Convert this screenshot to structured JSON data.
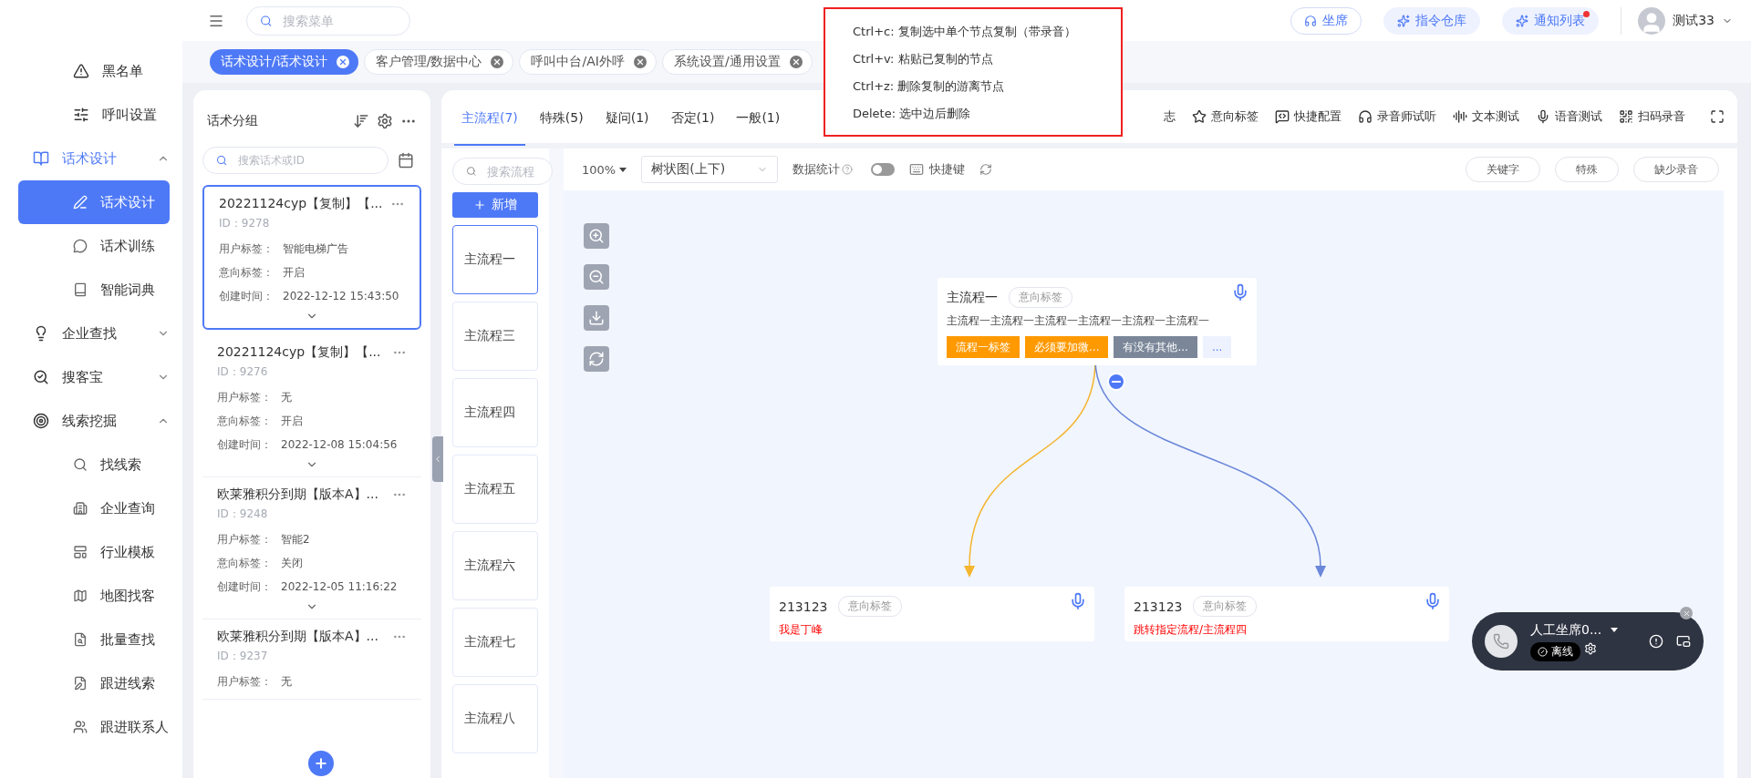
{
  "sidebar": {
    "items": [
      {
        "kind": "item",
        "label": "黑名单",
        "selected": false
      },
      {
        "kind": "item",
        "label": "呼叫设置",
        "selected": false
      },
      {
        "kind": "group",
        "label": "话术设计",
        "expanded": true,
        "selected": true,
        "children": [
          {
            "label": "话术设计",
            "selected": true
          },
          {
            "label": "话术训练",
            "selected": false
          },
          {
            "label": "智能词典",
            "selected": false
          }
        ]
      },
      {
        "kind": "group",
        "label": "企业查找",
        "expanded": false,
        "selected": false
      },
      {
        "kind": "group",
        "label": "搜客宝",
        "expanded": false,
        "selected": false
      },
      {
        "kind": "group",
        "label": "线索挖掘",
        "expanded": true,
        "selected": false,
        "children": [
          {
            "label": "找线索",
            "selected": false
          },
          {
            "label": "企业查询",
            "selected": false
          },
          {
            "label": "行业模板",
            "selected": false
          },
          {
            "label": "地图找客",
            "selected": false
          },
          {
            "label": "批量查找",
            "selected": false
          },
          {
            "label": "跟进线索",
            "selected": false
          },
          {
            "label": "跟进联系人",
            "selected": false
          }
        ]
      }
    ]
  },
  "header": {
    "search": {
      "placeholder": "搜索菜单"
    },
    "buttons": [
      {
        "label": "坐席",
        "kind": "outline",
        "badge": false
      },
      {
        "label": "指令仓库",
        "kind": "soft",
        "badge": false
      },
      {
        "label": "通知列表",
        "kind": "soft",
        "badge": true
      }
    ],
    "user": "测试33"
  },
  "open_tabs": [
    {
      "label": "话术设计/话术设计",
      "selected": true
    },
    {
      "label": "客户管理/数据中心",
      "selected": false
    },
    {
      "label": "呼叫中台/AI外呼",
      "selected": false
    },
    {
      "label": "系统设置/通用设置",
      "selected": false
    }
  ],
  "script_panel": {
    "title": "话术分组",
    "search": {
      "placeholder": "搜索话术或ID"
    },
    "cards": [
      {
        "title": "20221124cyp【复制】【...",
        "id": "ID：9278",
        "selected": true,
        "fields": [
          {
            "label": "用户标签：",
            "value": "智能电梯广告"
          },
          {
            "label": "意向标签：",
            "value": "开启"
          },
          {
            "label": "创建时间：",
            "value": "2022-12-12 15:43:50"
          }
        ]
      },
      {
        "title": "20221124cyp【复制】【...",
        "id": "ID：9276",
        "selected": false,
        "fields": [
          {
            "label": "用户标签：",
            "value": "无"
          },
          {
            "label": "意向标签：",
            "value": "开启"
          },
          {
            "label": "创建时间：",
            "value": "2022-12-08 15:04:56"
          }
        ]
      },
      {
        "title": "欧莱雅积分到期【版本A】...",
        "id": "ID：9248",
        "selected": false,
        "fields": [
          {
            "label": "用户标签：",
            "value": "智能2"
          },
          {
            "label": "意向标签：",
            "value": "关闭"
          },
          {
            "label": "创建时间：",
            "value": "2022-12-05 11:16:22"
          }
        ]
      },
      {
        "title": "欧莱雅积分到期【版本A】...",
        "id": "ID：9237",
        "selected": false,
        "fields": [
          {
            "label": "用户标签：",
            "value": "无"
          }
        ]
      }
    ]
  },
  "tabs": [
    {
      "label": "主流程(7)",
      "selected": true
    },
    {
      "label": "特殊(5)",
      "selected": false
    },
    {
      "label": "疑问(1)",
      "selected": false
    },
    {
      "label": "否定(1)",
      "selected": false
    },
    {
      "label": "一般(1)",
      "selected": false
    }
  ],
  "toolbar_actions": [
    {
      "label": "志",
      "kind": "text"
    },
    {
      "label": "意向标签",
      "kind": "star"
    },
    {
      "label": "快捷配置",
      "kind": "config"
    },
    {
      "label": "录音师试听",
      "kind": "headphones"
    },
    {
      "label": "文本测试",
      "kind": "wave"
    },
    {
      "label": "语音测试",
      "kind": "mic"
    },
    {
      "label": "扫码录音",
      "kind": "scan"
    }
  ],
  "flow_panel": {
    "search": {
      "placeholder": "搜索流程"
    },
    "add_button": "新增",
    "flows": [
      {
        "label": "主流程一",
        "selected": true
      },
      {
        "label": "主流程三",
        "selected": false
      },
      {
        "label": "主流程四",
        "selected": false
      },
      {
        "label": "主流程五",
        "selected": false
      },
      {
        "label": "主流程六",
        "selected": false
      },
      {
        "label": "主流程七",
        "selected": false
      },
      {
        "label": "主流程八",
        "selected": false
      }
    ]
  },
  "canvas_toolbar": {
    "zoom": "100%",
    "layout": "树状图(上下)",
    "stats_label": "数据统计",
    "stats_on": false,
    "shortcut_label": "快捷键",
    "filters": [
      "关键字",
      "特殊",
      "缺少录音"
    ]
  },
  "canvas": {
    "root": {
      "title": "主流程一",
      "tag": "意向标签",
      "text": "主流程一主流程一主流程一主流程一主流程一主流程一",
      "chips": [
        {
          "label": "流程一标签",
          "color": "#ff9900"
        },
        {
          "label": "必须要加微...",
          "color": "#ff9900"
        },
        {
          "label": "有没有其他...",
          "color": "#7b8799"
        },
        {
          "label": "...",
          "color": "#eef2ff"
        }
      ]
    },
    "children": [
      {
        "title": "213123",
        "tag": "意向标签",
        "text": "我是丁峰",
        "color": "#f5b52e"
      },
      {
        "title": "213123",
        "tag": "意向标签",
        "text": "跳转指定流程/主流程四",
        "color": "#6a87d9"
      }
    ]
  },
  "shortcuts": [
    {
      "key": "Ctrl+c:",
      "desc": "复制选中单个节点复制（带录音）"
    },
    {
      "key": "Ctrl+v:",
      "desc": "粘贴已复制的节点"
    },
    {
      "key": "Ctrl+z:",
      "desc": "删除复制的游离节点"
    },
    {
      "key": "Delete:",
      "desc": "选中边后删除"
    }
  ],
  "phone_widget": {
    "name": "人工坐席0...",
    "status": "离线"
  }
}
